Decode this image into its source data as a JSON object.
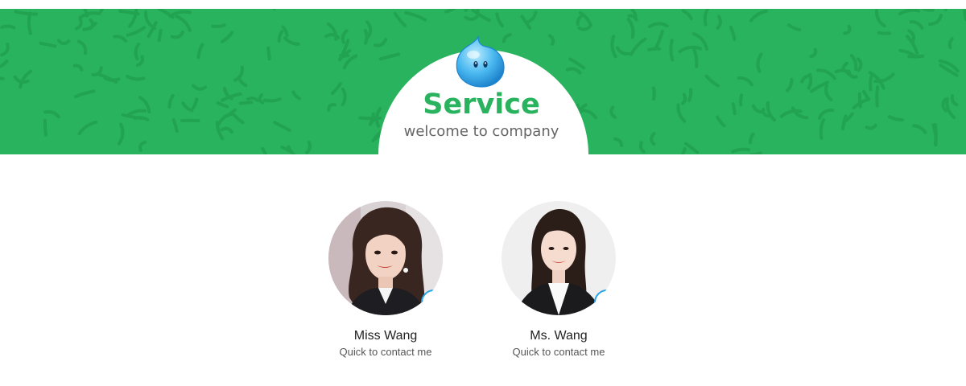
{
  "header": {
    "title": "Service",
    "subtitle": "welcome to company"
  },
  "contacts": [
    {
      "name": "Miss Wang",
      "action": "Quick to contact me"
    },
    {
      "name": "Ms. Wang",
      "action": "Quick to contact me"
    }
  ],
  "icons": {
    "header_mascot": "qq-mascot-icon",
    "badge": "qq-icon"
  },
  "colors": {
    "brand_green": "#29b35e",
    "pattern_green": "#1f9e4f",
    "qq_blue": "#2aa6e6",
    "subtitle_gray": "#666666"
  }
}
